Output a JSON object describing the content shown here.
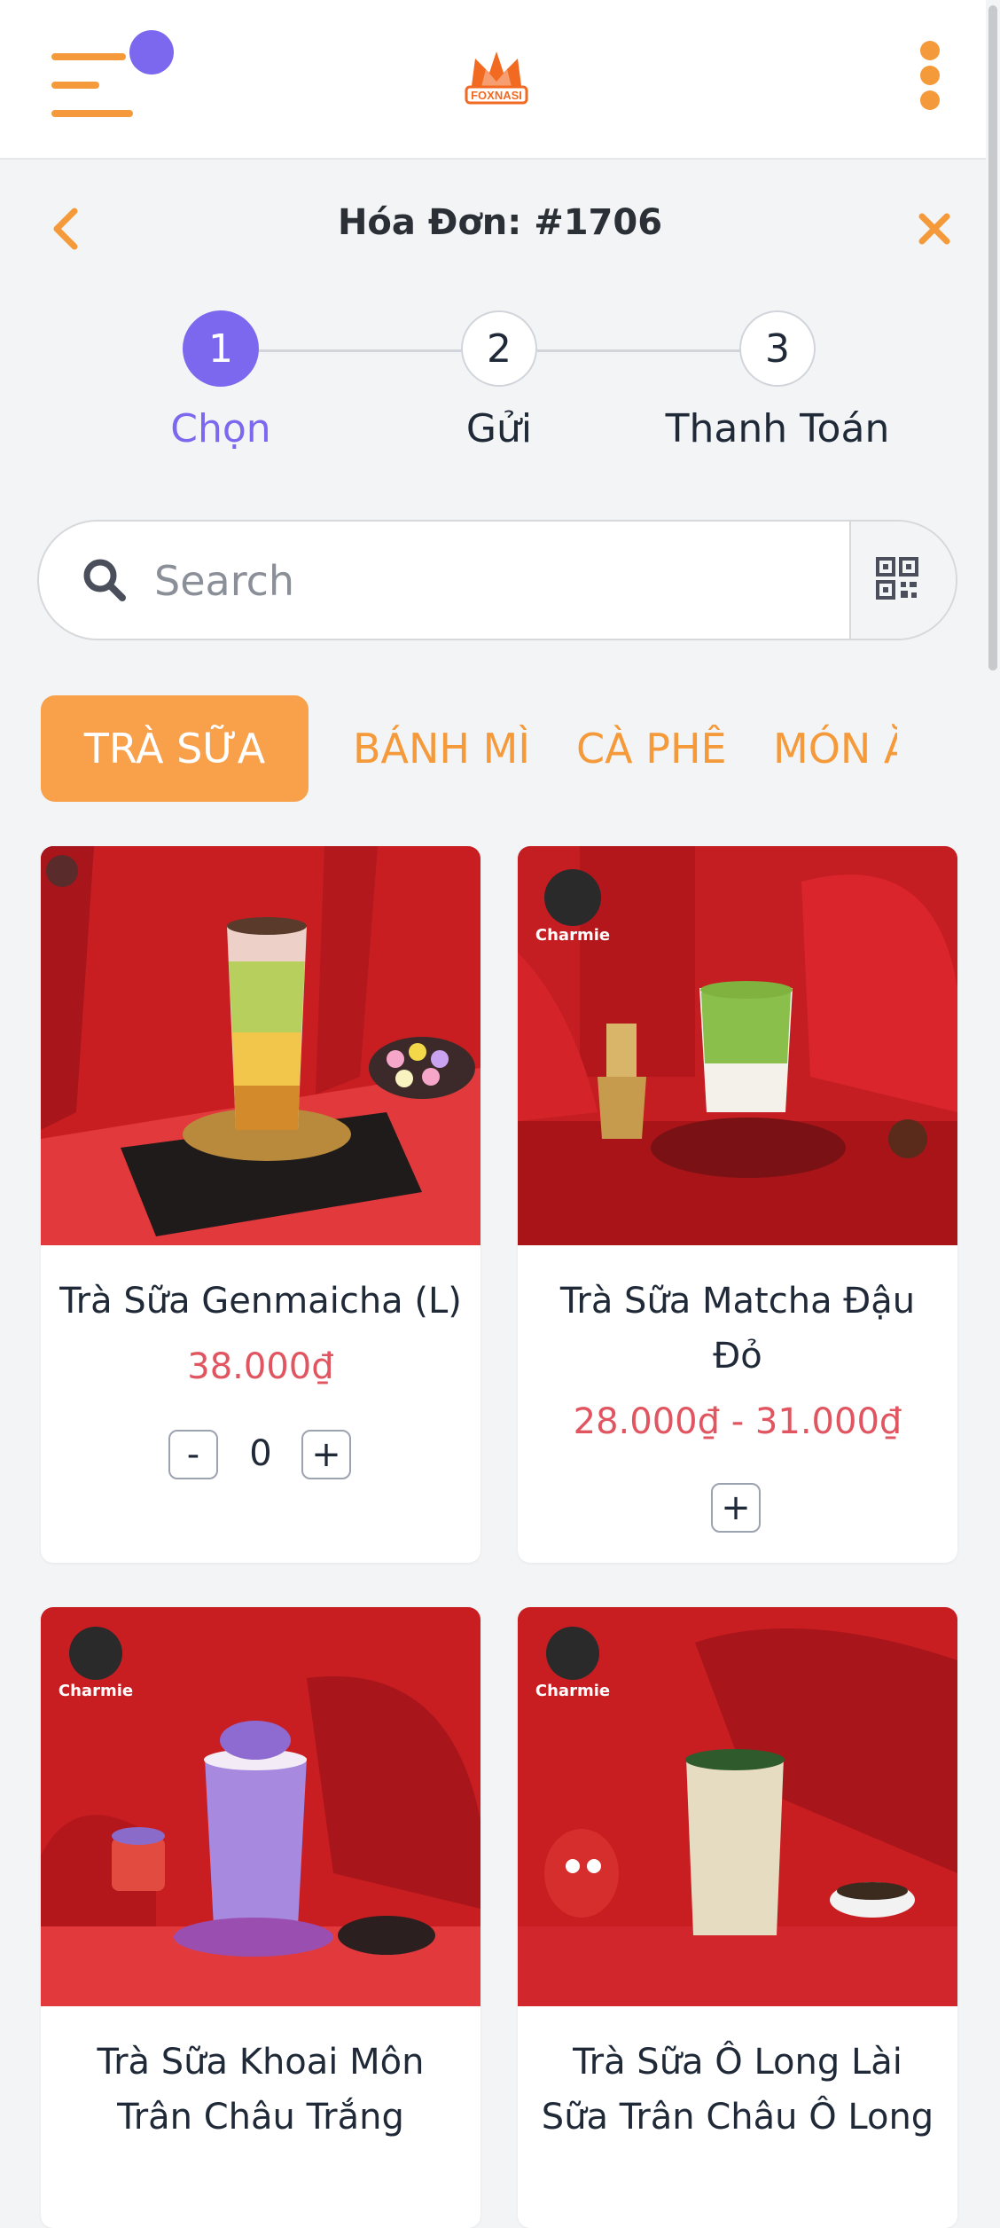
{
  "header": {
    "brand": "FOXNASI",
    "invoice_title": "Hóa Đơn: #1706"
  },
  "steps": [
    {
      "number": "1",
      "label": "Chọn",
      "active": true
    },
    {
      "number": "2",
      "label": "Gửi",
      "active": false
    },
    {
      "number": "3",
      "label": "Thanh Toán",
      "active": false
    }
  ],
  "search": {
    "placeholder": "Search",
    "value": ""
  },
  "categories": [
    "TRÀ SỮA",
    "BÁNH MÌ",
    "CÀ PHÊ",
    "MÓN ĂN"
  ],
  "active_category": "TRÀ SỮA",
  "products": [
    {
      "name": "Trà Sữa Genmaicha (L)",
      "price": "38.000₫",
      "quantity": "0",
      "minus": "-",
      "plus": "+"
    },
    {
      "name": "Trà Sữa Matcha Đậu Đỏ",
      "price": "28.000₫ - 31.000₫",
      "plus": "+"
    },
    {
      "name": "Trà Sữa Khoai Môn Trân Châu Trắng"
    },
    {
      "name": "Trà Sữa Ô Long Lài Sữa Trân Châu Ô Long"
    }
  ],
  "badge_text": "Charmie",
  "colors": {
    "accent": "#f59a3a",
    "primary": "#7b68ee",
    "price": "#e05560",
    "card_background": "#ffffff",
    "page_background": "#f3f4f6"
  },
  "icons": [
    "menu-icon",
    "notification-dot",
    "fox-logo",
    "more-vertical-icon",
    "back-arrow-icon",
    "close-icon",
    "search-icon",
    "qr-code-icon"
  ]
}
